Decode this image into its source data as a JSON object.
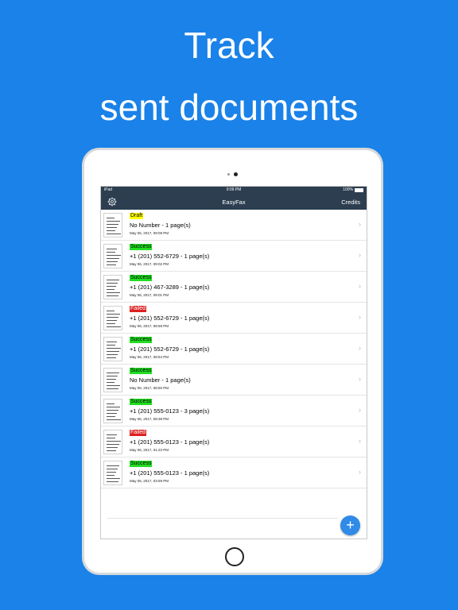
{
  "promo": {
    "line1": "Track",
    "line2": "sent documents"
  },
  "statusbar": {
    "carrier": "iPad",
    "time": "9:09 PM",
    "battery": "100%"
  },
  "navbar": {
    "settings_icon": "gear-icon",
    "title": "EasyFax",
    "credits_label": "Credits"
  },
  "faxes": [
    {
      "status": "Draft",
      "kind": "draft",
      "number": "No Number - 1 page(s)",
      "date": "May 06, 2017, 09:09 PM"
    },
    {
      "status": "Success",
      "kind": "success",
      "number": "+1 (201) 552-6729 - 1 page(s)",
      "date": "May 06, 2017, 09:02 PM"
    },
    {
      "status": "Success",
      "kind": "success",
      "number": "+1 (201) 467-3289 - 1 page(s)",
      "date": "May 06, 2017, 09:01 PM"
    },
    {
      "status": "Failed",
      "kind": "failed",
      "number": "+1 (201) 552-6729 - 1 page(s)",
      "date": "May 06, 2017, 08:59 PM"
    },
    {
      "status": "Success",
      "kind": "success",
      "number": "+1 (201) 552-6729 - 1 page(s)",
      "date": "May 06, 2017, 08:54 PM"
    },
    {
      "status": "Success",
      "kind": "success",
      "number": "No Number - 1 page(s)",
      "date": "May 06, 2017, 08:50 PM"
    },
    {
      "status": "Success",
      "kind": "success",
      "number": "+1 (201) 555-0123 - 3 page(s)",
      "date": "May 06, 2017, 08:38 PM"
    },
    {
      "status": "Failed",
      "kind": "failed",
      "number": "+1 (201) 555-0123 - 1 page(s)",
      "date": "May 06, 2017, 01:23 PM"
    },
    {
      "status": "Success",
      "kind": "success",
      "number": "+1 (201) 555-0123 - 1 page(s)",
      "date": "May 05, 2017, 03:59 PM"
    }
  ],
  "fab": {
    "label": "+",
    "icon": "plus-icon"
  },
  "colors": {
    "background": "#1a82e8",
    "navbar": "#2c3e50",
    "draft": "#ffff00",
    "success": "#22dd22",
    "failed": "#dd2222",
    "fab": "#2f8ae8"
  }
}
